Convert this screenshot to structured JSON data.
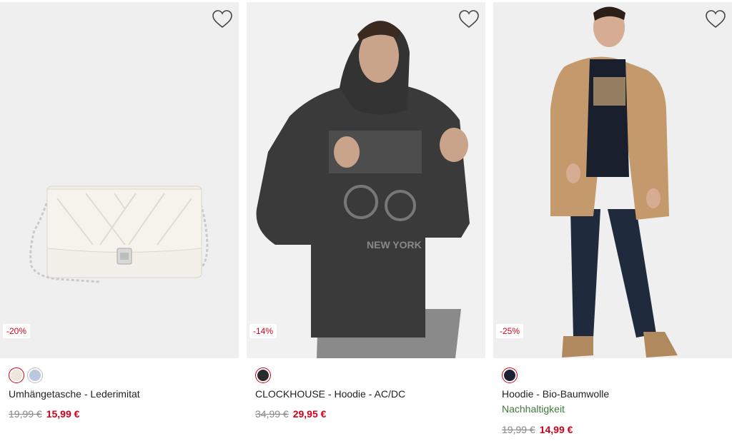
{
  "products": [
    {
      "title": "Umhängetasche - Lederimitat",
      "discount": "-20%",
      "old_price": "19,99 €",
      "new_price": "15,99 €",
      "swatches": [
        "#ece6dc",
        "#b9c8dc"
      ],
      "wishlist_icon": "heart-outline-icon"
    },
    {
      "title": "CLOCKHOUSE - Hoodie - AC/DC",
      "discount": "-14%",
      "old_price": "34,99 €",
      "new_price": "29,95 €",
      "swatches": [
        "#2b2b2b"
      ],
      "wishlist_icon": "heart-outline-icon"
    },
    {
      "title": "Hoodie - Bio-Baumwolle",
      "sustainability": "Nachhaltigkeit",
      "discount": "-25%",
      "old_price": "19,99 €",
      "new_price": "14,99 €",
      "swatches": [
        "#1c2233"
      ],
      "wishlist_icon": "heart-outline-icon"
    }
  ],
  "colors": {
    "sale_red": "#d0021b",
    "sustain_green": "#3e7a3a"
  }
}
